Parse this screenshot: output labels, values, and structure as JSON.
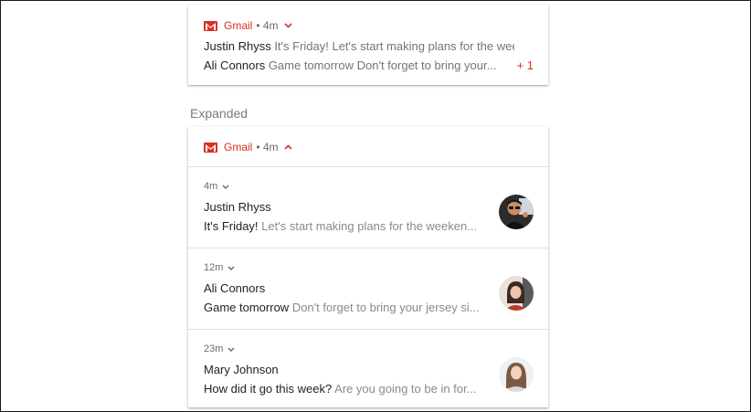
{
  "collapsed_card": {
    "app_name": "Gmail",
    "time": "• 4m",
    "lines": [
      {
        "sender": "Justin Rhyss",
        "text": " It's Friday! Let's start making plans for the wee..."
      },
      {
        "sender": "Ali Connors",
        "text": " Game tomorrow Don't forget to bring your..."
      }
    ],
    "more_count": "+ 1"
  },
  "section_label": "Expanded",
  "expanded_card": {
    "app_name": "Gmail",
    "time": "• 4m",
    "messages": [
      {
        "time": "4m",
        "name": "Justin Rhyss",
        "subject": "It's Friday!",
        "preview": " Let's start making plans for the weeken...",
        "avatar": "person-avatar"
      },
      {
        "time": "12m",
        "name": "Ali Connors",
        "subject": "Game tomorrow",
        "preview": " Don't forget to bring your jersey si...",
        "avatar": "person-avatar"
      },
      {
        "time": "23m",
        "name": "Mary Johnson",
        "subject": "How did it go this week?",
        "preview": " Are you going to be in for...",
        "avatar": "person-avatar"
      }
    ]
  },
  "colors": {
    "accent": "#d93025",
    "primary_text": "#222222",
    "secondary_text": "#757575",
    "divider": "#e0e0e0"
  }
}
